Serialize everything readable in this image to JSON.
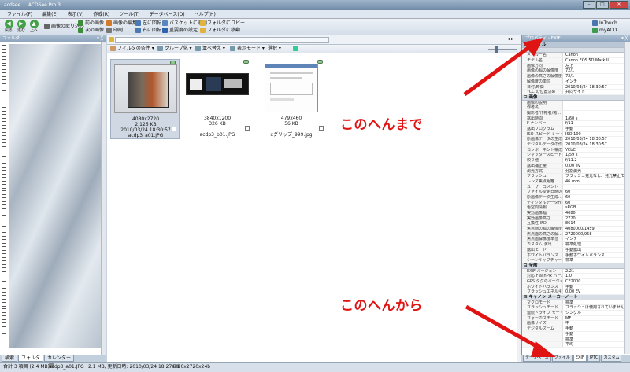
{
  "window": {
    "title": "acdsee ... ACDSee Pro 3",
    "min": "–",
    "max": "□",
    "close": "✕"
  },
  "menu": [
    "ファイル(F)",
    "編集(E)",
    "表示(V)",
    "作成(R)",
    "ツール(T)",
    "データベース(D)",
    "ヘルプ(H)"
  ],
  "toolbar": {
    "back": "戻る",
    "forward": "進む",
    "up": "上へ",
    "import": "画像の取り込み",
    "prev_image": "前の画像",
    "next_image": "次の画像",
    "edit_image": "画像の編集",
    "print": "印刷",
    "rotate_left": "左に回転",
    "rotate_right": "右に回転",
    "add_basket": "バスケットに追加",
    "set_rating": "重要度の設定",
    "copy_folder": "フォルダにコピー",
    "move_folder": "フォルダに移動",
    "intouch": "InTouch",
    "myacd": "myACD"
  },
  "folder_panel": {
    "title": "フォルダ",
    "pin": "▾ ╳"
  },
  "left_tabs": [
    "検索",
    "フォルダ",
    "カレンダー"
  ],
  "filterbar": {
    "filter": "フィルタの条件",
    "group": "グループ化",
    "sort": "並べ替え",
    "view": "表示モード",
    "select": "選択"
  },
  "thumbnails": [
    {
      "dims": "4080x2720",
      "size": "2,126 KB",
      "date": "2010/03/24 18:30:57",
      "name": "acdp3_a01.JPG",
      "selected": true
    },
    {
      "dims": "3840x1200",
      "size": "326 KB",
      "date": "",
      "name": "acdp3_b01.JPG",
      "selected": false
    },
    {
      "dims": "479x460",
      "size": "56 KB",
      "date": "",
      "name": "xグリップ_999.jpg",
      "selected": false
    }
  ],
  "properties": {
    "title": "プロパティ - EXIF",
    "pin": "▾ ╳",
    "file_group": "ファイル",
    "file_sub": "基本",
    "rows": [
      {
        "k": "メーカー名",
        "v": "Canon"
      },
      {
        "k": "モデル名",
        "v": "Canon EOS 5D Mark II"
      },
      {
        "k": "画像方向",
        "v": "左上"
      },
      {
        "k": "画像の幅の解像度",
        "v": "72/1"
      },
      {
        "k": "画像の高さの解像度",
        "v": "72/1"
      },
      {
        "k": "解像度の単位",
        "v": "インチ"
      },
      {
        "k": "日付/時間",
        "v": "2010/03/24 18:30:57"
      },
      {
        "k": "YCC の位置決め",
        "v": "共同サイト"
      }
    ],
    "image_group": "画像",
    "rows2": [
      {
        "k": "画像の説明",
        "v": ""
      },
      {
        "k": "作者名",
        "v": ""
      },
      {
        "k": "撮影者/作権者/権...",
        "v": ""
      },
      {
        "k": "露出時間",
        "v": "1/60 s"
      },
      {
        "k": "F ナンバー",
        "v": "f/11"
      },
      {
        "k": "露出プログラム",
        "v": "手動"
      },
      {
        "k": "ISO スピード レート",
        "v": "ISO 100"
      },
      {
        "k": "原画像データの生成...",
        "v": "2010/03/24 18:30:57"
      },
      {
        "k": "デジタルデータの作...",
        "v": "2010/03/24 18:30:57"
      },
      {
        "k": "コンポーネント構成",
        "v": "YCbCr"
      },
      {
        "k": "シャッタースピード",
        "v": "1/59 s"
      },
      {
        "k": "絞り値",
        "v": "f/11.2"
      },
      {
        "k": "露出補正量",
        "v": "0.00 eV"
      },
      {
        "k": "測光方式",
        "v": "分割測光"
      },
      {
        "k": "フラッシュ",
        "v": "フラッシュ発光なし、発光禁止モード"
      },
      {
        "k": "レンズ焦点距離",
        "v": "46 mm"
      },
      {
        "k": "ユーザーコメント",
        "v": ""
      },
      {
        "k": "ファイル変更日時の...",
        "v": "60"
      },
      {
        "k": "原画像データ生成...",
        "v": "60"
      },
      {
        "k": "ディジタルデータ作成...",
        "v": "60"
      },
      {
        "k": "色空間情報",
        "v": "sRGB"
      },
      {
        "k": "実効画像幅",
        "v": "4080"
      },
      {
        "k": "実効画像高さ",
        "v": "2720"
      },
      {
        "k": "互換性 IFD",
        "v": "8614"
      },
      {
        "k": "焦点面の幅の解像度",
        "v": "4080000/1459"
      },
      {
        "k": "焦点面の高さの解...",
        "v": "2720000/958"
      },
      {
        "k": "焦点面解像度単位",
        "v": "インチ"
      },
      {
        "k": "カスタム 演出",
        "v": "標準処理"
      },
      {
        "k": "露出モード",
        "v": "手動露出"
      },
      {
        "k": "ホワイトバランス",
        "v": "手動ホワイトバランス"
      },
      {
        "k": "シーンキャプチャー...",
        "v": "標準"
      }
    ],
    "misc_group": "全般",
    "rows3": [
      {
        "k": "EXIF バージョン",
        "v": "2.21"
      },
      {
        "k": "対応 FlashPix バー...",
        "v": "1.0"
      },
      {
        "k": "GPS タグのバージョン",
        "v": "CE2000"
      },
      {
        "k": "ホワイトバランス",
        "v": "手動"
      },
      {
        "k": "フラッシュエネルギー",
        "v": "0.00 EV"
      }
    ],
    "maker_group": "キャノン メーカーノート",
    "rows4": [
      {
        "k": "マクロモード",
        "v": "標準"
      },
      {
        "k": "フラッシュモード",
        "v": "フラッシュは使用されていません"
      },
      {
        "k": "連続ドライブ モード",
        "v": "シングル"
      },
      {
        "k": "フォーカスモード",
        "v": "MF"
      },
      {
        "k": "画像サイズ",
        "v": "中"
      },
      {
        "k": "デジタルズーム",
        "v": "手動"
      },
      {
        "k": "",
        "v": "手動"
      },
      {
        "k": "",
        "v": "標準"
      },
      {
        "k": "",
        "v": "平均"
      }
    ]
  },
  "right_tabs": [
    "データベース",
    "ファイル",
    "EXIF",
    "IPTC",
    "カスタム"
  ],
  "statusbar": {
    "count": "合計 3 項目 (2.4 MB)",
    "file": "acdp3_a01.JPG",
    "info": "2.1 MB, 更新日時: 2010/03/24 18:27:38",
    "dims": "4080x2720x24b"
  },
  "annotations": {
    "upper": "このへんまで",
    "lower": "このへんから"
  },
  "colors": {
    "annotation": "#e11414",
    "selection": "#cfd8e3"
  }
}
